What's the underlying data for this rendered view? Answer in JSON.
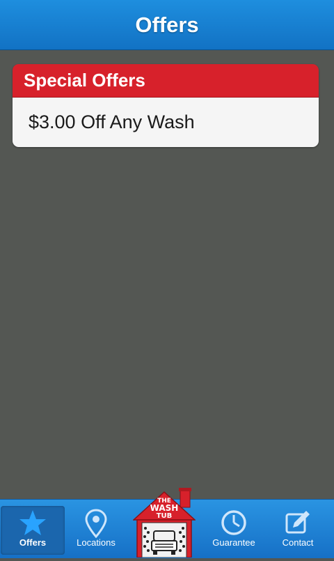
{
  "header": {
    "title": "Offers"
  },
  "offers_card": {
    "heading": "Special Offers",
    "items": [
      {
        "text": "$3.00 Off Any Wash"
      }
    ]
  },
  "tabbar": {
    "tabs": [
      {
        "label": "Offers",
        "icon": "star-icon",
        "active": true
      },
      {
        "label": "Locations",
        "icon": "map-pin-icon",
        "active": false
      },
      {
        "label": "Guarantee",
        "icon": "clock-icon",
        "active": false
      },
      {
        "label": "Contact",
        "icon": "edit-icon",
        "active": false
      }
    ],
    "logo": {
      "line1": "THE",
      "line2": "WASH",
      "line3": "TUB"
    }
  },
  "colors": {
    "header_blue": "#1a82d6",
    "card_red": "#d7212b",
    "background": "#545753",
    "active_tab": "#1b66ad"
  }
}
